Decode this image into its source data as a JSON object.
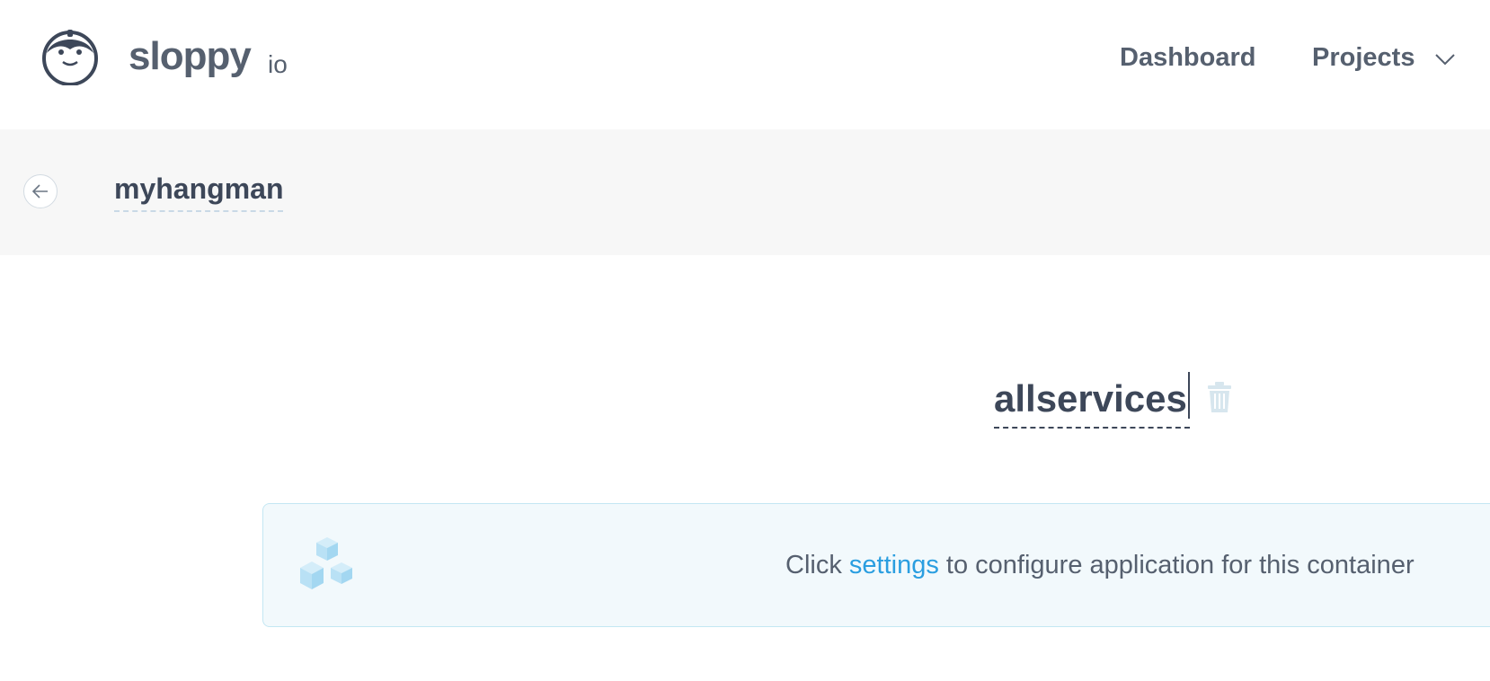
{
  "brand": {
    "name": "sloppy",
    "suffix": "io"
  },
  "nav": {
    "dashboard": "Dashboard",
    "projects": "Projects"
  },
  "project": {
    "name": "myhangman"
  },
  "service": {
    "name": "allservices"
  },
  "info": {
    "prefix": "Click ",
    "link": "settings",
    "suffix": " to configure application for this container"
  },
  "icons": {
    "logo": "sloth-logo-icon",
    "back": "arrow-left-icon",
    "chevron": "chevron-down-icon",
    "trash": "trash-icon",
    "cubes": "cubes-icon"
  },
  "colors": {
    "text": "#3d4759",
    "muted": "#56606f",
    "link": "#2a9ee0",
    "info_bg": "#f2f9fc",
    "info_border": "#c4e7f3",
    "subheader_bg": "#f7f7f7"
  }
}
